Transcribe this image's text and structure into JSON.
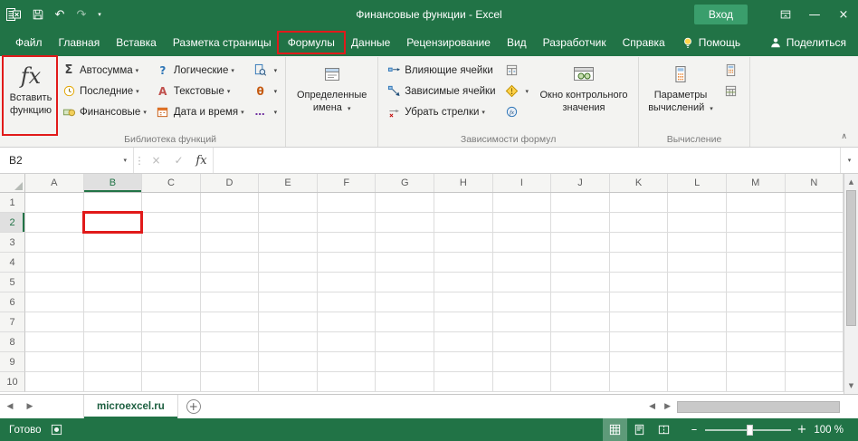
{
  "colors": {
    "excel_green": "#217346",
    "annotation_red": "#e11a1a"
  },
  "title_bar": {
    "app_title": "Финансовые функции - Excel",
    "sign_in": "Вход"
  },
  "tabs": {
    "file": "Файл",
    "home": "Главная",
    "insert": "Вставка",
    "layout": "Разметка страницы",
    "formulas": "Формулы",
    "data": "Данные",
    "review": "Рецензирование",
    "view": "Вид",
    "developer": "Разработчик",
    "help": "Справка",
    "tell_me": "Помощь",
    "share": "Поделиться"
  },
  "ribbon": {
    "insert_function_label": "Вставить функцию",
    "library": {
      "autosum": "Автосумма",
      "recent": "Последние",
      "financial": "Финансовые",
      "logical": "Логические",
      "text": "Текстовые",
      "datetime": "Дата и время",
      "group_label": "Библиотека функций"
    },
    "defined_names_label": "Определенные имена",
    "auditing": {
      "trace_precedents": "Влияющие ячейки",
      "trace_dependents": "Зависимые ячейки",
      "remove_arrows": "Убрать стрелки",
      "watch_window": "Окно контрольного значения",
      "group_label": "Зависимости формул"
    },
    "calculation": {
      "options": "Параметры вычислений",
      "group_label": "Вычисление"
    }
  },
  "formula_bar": {
    "name_box": "B2",
    "formula_value": ""
  },
  "grid": {
    "columns": [
      "A",
      "B",
      "C",
      "D",
      "E",
      "F",
      "G",
      "H",
      "I",
      "J",
      "K",
      "L",
      "M",
      "N"
    ],
    "rows": [
      "1",
      "2",
      "3",
      "4",
      "5",
      "6",
      "7",
      "8",
      "9",
      "10"
    ],
    "selected_cell": "B2",
    "selected_column": "B",
    "selected_row": "2"
  },
  "sheet_bar": {
    "active_tab": "microexcel.ru"
  },
  "status_bar": {
    "ready": "Готово",
    "zoom_level": "100 %"
  },
  "glyphs": {
    "undo": "↶",
    "redo": "↷",
    "caret_down": "▾",
    "minimize": "—",
    "close": "×",
    "cancel": "×",
    "check": "✓",
    "vertical_dots": "⋮",
    "fx": "fx",
    "sigma": "Σ",
    "question": "?",
    "letter_a": "А",
    "theta": "θ",
    "ellipsis": "…",
    "collapse": "∧",
    "up_arrow": "▲",
    "down_arrow": "▼",
    "left_arrow": "◀",
    "right_arrow": "▶",
    "plus": "+",
    "minus": "–"
  }
}
